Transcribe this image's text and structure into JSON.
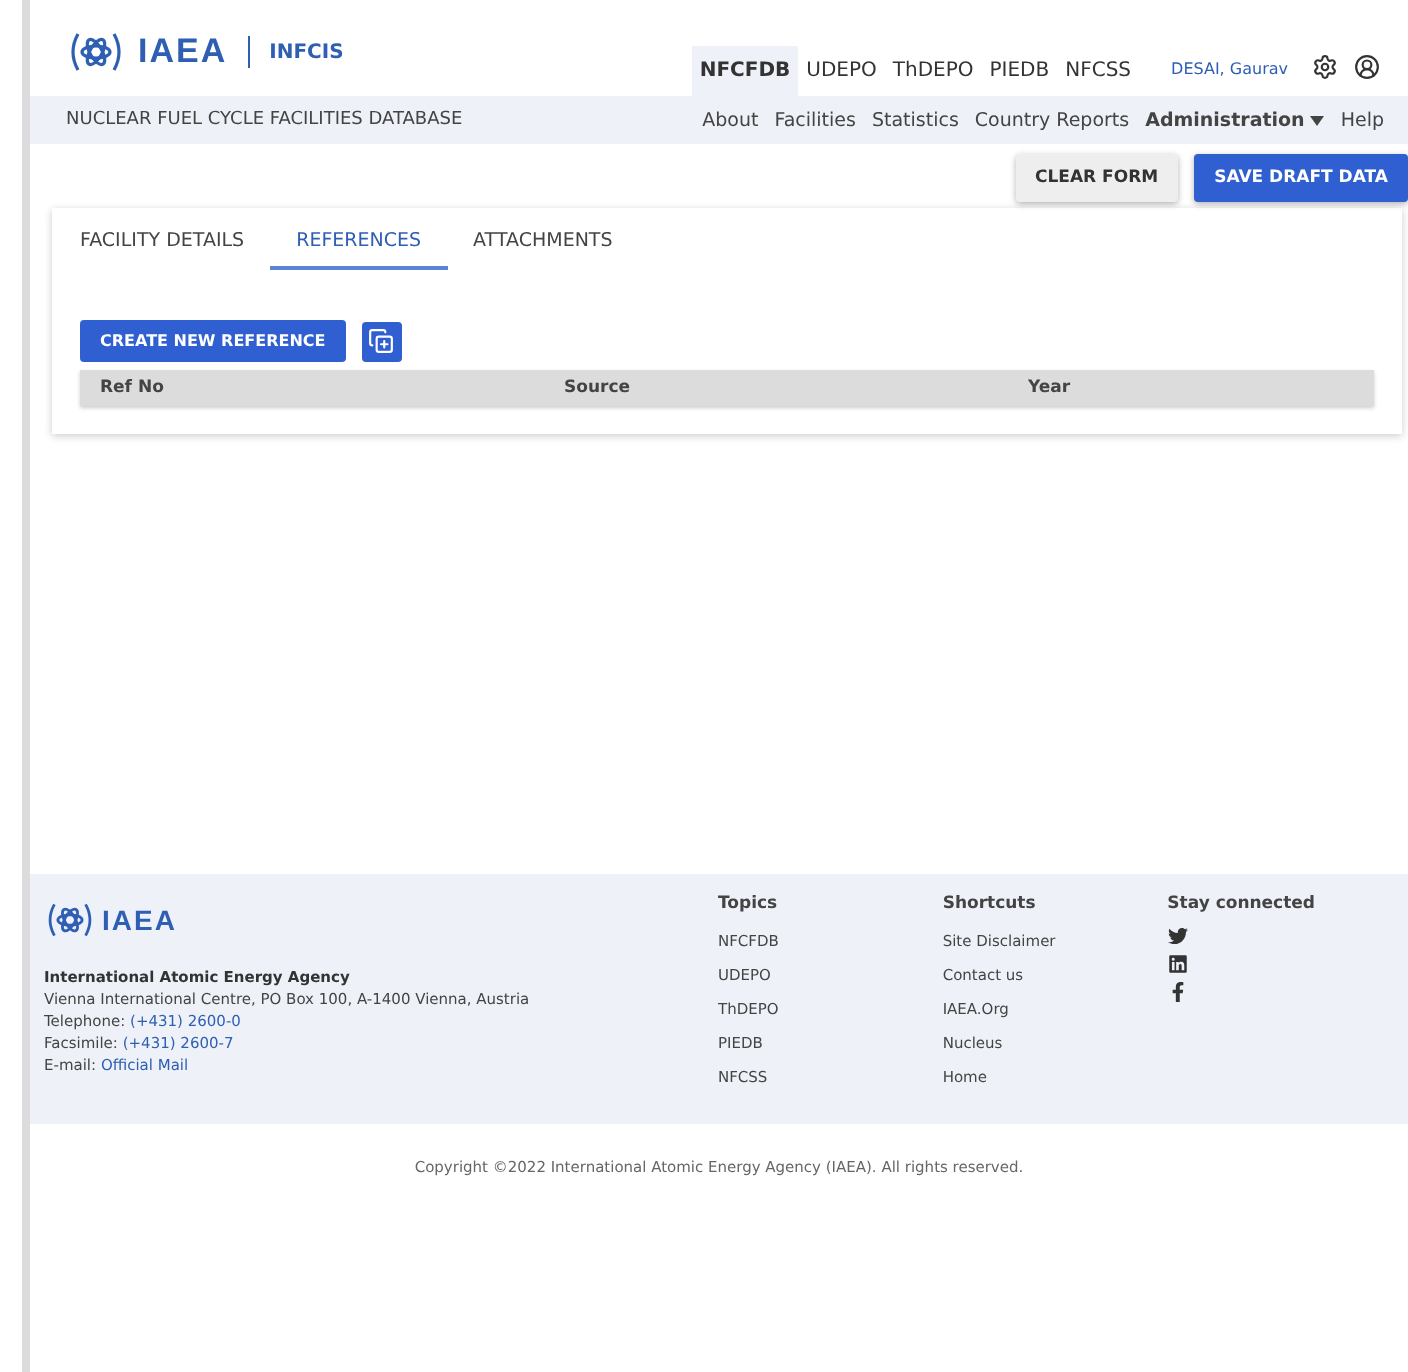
{
  "header": {
    "logo": "IAEA",
    "app_name": "INFCIS",
    "databases": [
      {
        "label": "NFCFDB",
        "selected": true
      },
      {
        "label": "UDEPO",
        "selected": false
      },
      {
        "label": "ThDEPO",
        "selected": false
      },
      {
        "label": "PIEDB",
        "selected": false
      },
      {
        "label": "NFCSS",
        "selected": false
      }
    ],
    "user": "DESAI, Gaurav"
  },
  "subheader": {
    "title": "NUCLEAR FUEL CYCLE FACILITIES DATABASE",
    "menu": [
      {
        "label": "About",
        "kind": "link"
      },
      {
        "label": "Facilities",
        "kind": "link"
      },
      {
        "label": "Statistics",
        "kind": "link"
      },
      {
        "label": "Country Reports",
        "kind": "link"
      },
      {
        "label": "Administration",
        "kind": "dropdown"
      },
      {
        "label": "Help",
        "kind": "link"
      }
    ]
  },
  "actions": [
    {
      "label": "CLEAR FORM",
      "kind": "secondary"
    },
    {
      "label": "SAVE DRAFT DATA",
      "kind": "primary"
    }
  ],
  "tabs": [
    {
      "label": "FACILITY DETAILS",
      "selected": false
    },
    {
      "label": "REFERENCES",
      "selected": true
    },
    {
      "label": "ATTACHMENTS",
      "selected": false
    }
  ],
  "create_button": "CREATE NEW REFERENCE",
  "table": {
    "columns": [
      "Ref No",
      "Source",
      "Year"
    ]
  },
  "footer": {
    "logo": "IAEA",
    "org": "International Atomic Energy Agency",
    "address": "Vienna International Centre, PO Box 100, A-1400 Vienna, Austria",
    "contacts": [
      {
        "label": "Telephone:",
        "value": "(+431) 2600-0"
      },
      {
        "label": "Facsimile:",
        "value": "(+431) 2600-7"
      },
      {
        "label": "E-mail:",
        "value": "Official Mail"
      }
    ],
    "columns": [
      {
        "heading": "Topics",
        "links": [
          "NFCFDB",
          "UDEPO",
          "ThDEPO",
          "PIEDB",
          "NFCSS"
        ]
      },
      {
        "heading": "Shortcuts",
        "links": [
          "Site Disclaimer",
          "Contact us",
          "IAEA.Org",
          "Nucleus",
          "Home"
        ]
      }
    ],
    "social": {
      "heading": "Stay connected"
    }
  },
  "copyright": "Copyright ©2022 International Atomic Energy Agency (IAEA). All rights reserved."
}
